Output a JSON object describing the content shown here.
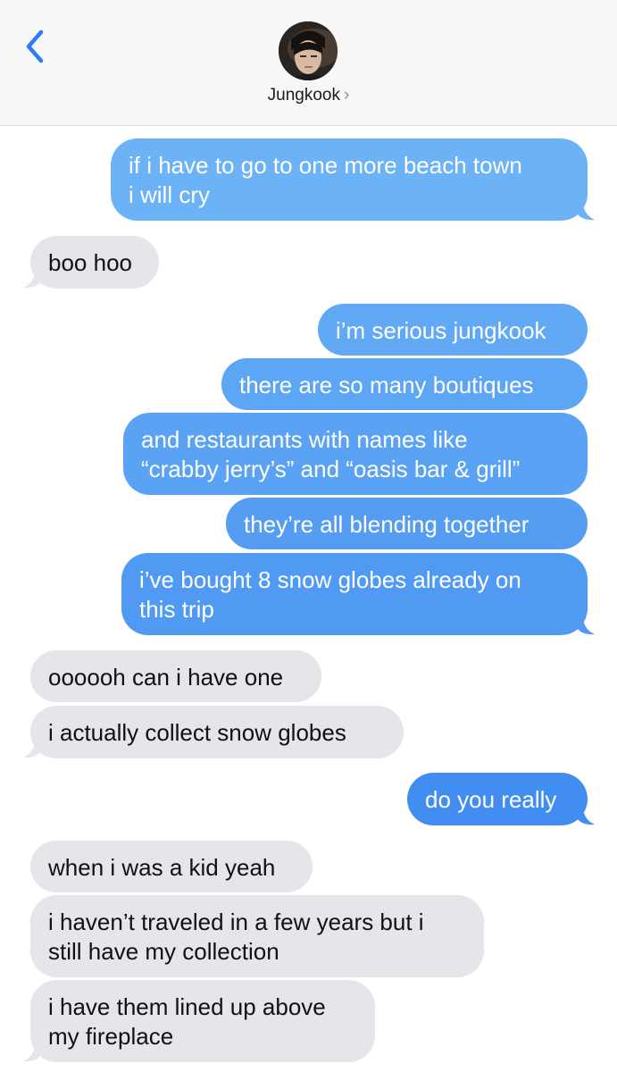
{
  "header": {
    "contact_name": "Jungkook",
    "chevron": "›",
    "back_icon": "chevron-left-icon",
    "accent_color": "#2f7cf6"
  },
  "colors": {
    "sent_top": "#6cb2f7",
    "sent_bottom": "#3e8af0",
    "received": "#e5e5ea"
  },
  "messages": [
    {
      "from": "me",
      "lines": [
        "if i have to go to one more beach town",
        "i will cry"
      ]
    },
    {
      "from": "them",
      "lines": [
        "boo hoo"
      ]
    },
    {
      "from": "me",
      "lines": [
        "i’m serious jungkook"
      ]
    },
    {
      "from": "me",
      "lines": [
        "there are so many boutiques"
      ]
    },
    {
      "from": "me",
      "lines": [
        "and restaurants with names like",
        "“crabby jerry’s” and “oasis bar & grill”"
      ]
    },
    {
      "from": "me",
      "lines": [
        "they’re all blending together"
      ]
    },
    {
      "from": "me",
      "lines": [
        "i’ve bought 8 snow globes already on",
        "this trip"
      ]
    },
    {
      "from": "them",
      "lines": [
        "oooooh can i have one"
      ]
    },
    {
      "from": "them",
      "lines": [
        "i actually collect snow globes"
      ]
    },
    {
      "from": "me",
      "lines": [
        "do you really"
      ]
    },
    {
      "from": "them",
      "lines": [
        "when i was a kid yeah"
      ]
    },
    {
      "from": "them",
      "lines": [
        "i haven’t traveled in a few years but i",
        "still have my collection"
      ]
    },
    {
      "from": "them",
      "lines": [
        "i have them lined up above",
        "my fireplace"
      ]
    }
  ]
}
